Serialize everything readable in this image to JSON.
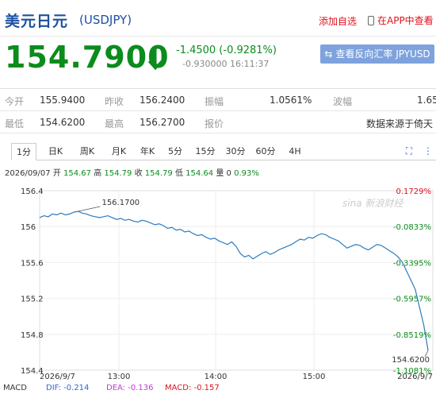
{
  "header": {
    "name": "美元日元",
    "code": "(USDJPY)",
    "watch_label": "添加自选",
    "app_label": "在APP中查看"
  },
  "price": {
    "last": "154.7900",
    "change": "-1.4500 (-0.9281%)",
    "sub_change": "-0.930000",
    "time": "16:11:37",
    "reverse_label": "查看反向汇率 JPYUSD"
  },
  "quote": {
    "open_label": "今开",
    "open": "155.9400",
    "prev_label": "昨收",
    "prev": "156.2400",
    "amp_label": "振幅",
    "amp": "1.0561%",
    "wave_label": "波幅",
    "wave": "1.65",
    "low_label": "最低",
    "low": "154.6200",
    "high_label": "最高",
    "high": "156.2700",
    "bid_label": "报价",
    "source": "数据来源于倚天"
  },
  "tabs": [
    "1分",
    "日K",
    "周K",
    "月K",
    "年K",
    "5分",
    "15分",
    "30分",
    "60分",
    "4H"
  ],
  "info": {
    "date": "2026/09/07",
    "open_label": "开",
    "open": "154.67",
    "high_label": "高",
    "high": "154.79",
    "close_label": "收",
    "close": "154.79",
    "low_label": "低",
    "low": "154.64",
    "vol_label": "量",
    "vol": "0",
    "pct": "0.93%"
  },
  "chart_data": {
    "type": "line",
    "yticks": [
      "156.4",
      "156",
      "155.6",
      "155.2",
      "154.8",
      "154.4"
    ],
    "ylim": [
      154.4,
      156.4
    ],
    "pct_ticks": [
      "0.1729%",
      "-0.0833%",
      "-0.3395%",
      "-0.5957%",
      "-0.8519%",
      "-1.1081%"
    ],
    "xticks": [
      "2026/9/7",
      "13:00",
      "14:00",
      "15:00",
      "2026/9/7"
    ],
    "high_label": "156.1700",
    "low_label": "154.6200",
    "watermark": "sina 新浪财经",
    "macd": {
      "macd_label": "MACD",
      "dif_label": "DIF: -0.214",
      "dea_label": "DEA: -0.136",
      "macd_value_label": "MACD: -0.157"
    },
    "series": [
      {
        "values": [
          156.1,
          156.12,
          156.11,
          156.14,
          156.13,
          156.15,
          156.13,
          156.14,
          156.16,
          156.17,
          156.15,
          156.14,
          156.12,
          156.11,
          156.1,
          156.11,
          156.12,
          156.1,
          156.08,
          156.09,
          156.07,
          156.08,
          156.06,
          156.05,
          156.07,
          156.06,
          156.04,
          156.02,
          156.03,
          156.01,
          155.98,
          155.99,
          155.96,
          155.97,
          155.94,
          155.95,
          155.92,
          155.9,
          155.91,
          155.88,
          155.86,
          155.87,
          155.84,
          155.82,
          155.8,
          155.83,
          155.78,
          155.7,
          155.66,
          155.68,
          155.64,
          155.67,
          155.7,
          155.72,
          155.69,
          155.71,
          155.74,
          155.76,
          155.78,
          155.8,
          155.83,
          155.86,
          155.85,
          155.88,
          155.87,
          155.9,
          155.92,
          155.91,
          155.88,
          155.86,
          155.84,
          155.8,
          155.76,
          155.78,
          155.8,
          155.79,
          155.76,
          155.74,
          155.77,
          155.8,
          155.79,
          155.76,
          155.73,
          155.7,
          155.66,
          155.6,
          155.5,
          155.4,
          155.3,
          155.1,
          154.9,
          154.62
        ]
      }
    ]
  }
}
